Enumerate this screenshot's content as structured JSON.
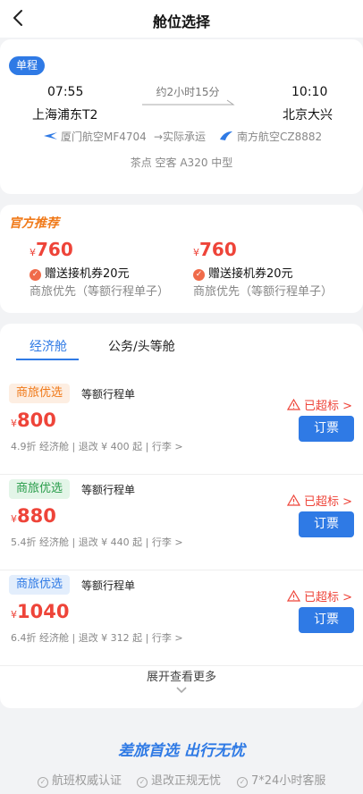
{
  "header": {
    "title": "舱位选择"
  },
  "flight": {
    "trip_type": "单程",
    "depart_time": "07:55",
    "depart_airport": "上海浦东T2",
    "arrive_time": "10:10",
    "arrive_airport": "北京大兴",
    "duration": "约2小时15分",
    "marketing_carrier": "厦门航空MF4704",
    "operated_label": "→实际承运",
    "operating_carrier": "南方航空CZ8882",
    "aircraft": "茶点 空客 A320 中型"
  },
  "recommend": {
    "title": "官方推荐",
    "items": [
      {
        "currency": "¥",
        "price": "760",
        "gift": "赠送接机券20元",
        "desc": "商旅优先（等额行程单子）"
      },
      {
        "currency": "¥",
        "price": "760",
        "gift": "赠送接机券20元",
        "desc": "商旅优先（等额行程单子）"
      }
    ]
  },
  "cabin_tabs": [
    {
      "label": "经济舱",
      "active": true
    },
    {
      "label": "公务/头等舱",
      "active": false
    }
  ],
  "fares": [
    {
      "tag": "商旅优选",
      "tag_color": "orange",
      "note": "等额行程单",
      "currency": "¥",
      "price": "800",
      "detail": "4.9折 经济舱 | 退改 ¥ 400 起 | 行李 >",
      "over_label": "已超标 >",
      "book_label": "订票"
    },
    {
      "tag": "商旅优选",
      "tag_color": "green",
      "note": "等额行程单",
      "currency": "¥",
      "price": "880",
      "detail": "5.4折 经济舱 | 退改 ¥ 440 起 | 行李 >",
      "over_label": "已超标 >",
      "book_label": "订票"
    },
    {
      "tag": "商旅优选",
      "tag_color": "blue",
      "note": "等额行程单",
      "currency": "¥",
      "price": "1040",
      "detail": "6.4折 经济舱 | 退改 ¥ 312 起 | 行李 >",
      "over_label": "已超标 >",
      "book_label": "订票"
    }
  ],
  "more_label": "展开查看更多",
  "footer": {
    "slogan": "差旅首选  出行无忧",
    "assurances": [
      "航班权威认证",
      "退改正规无忧",
      "7*24小时客服"
    ]
  },
  "colors": {
    "accent": "#2f7ae5",
    "price": "#ee4439",
    "recommend": "#f07a1a"
  }
}
